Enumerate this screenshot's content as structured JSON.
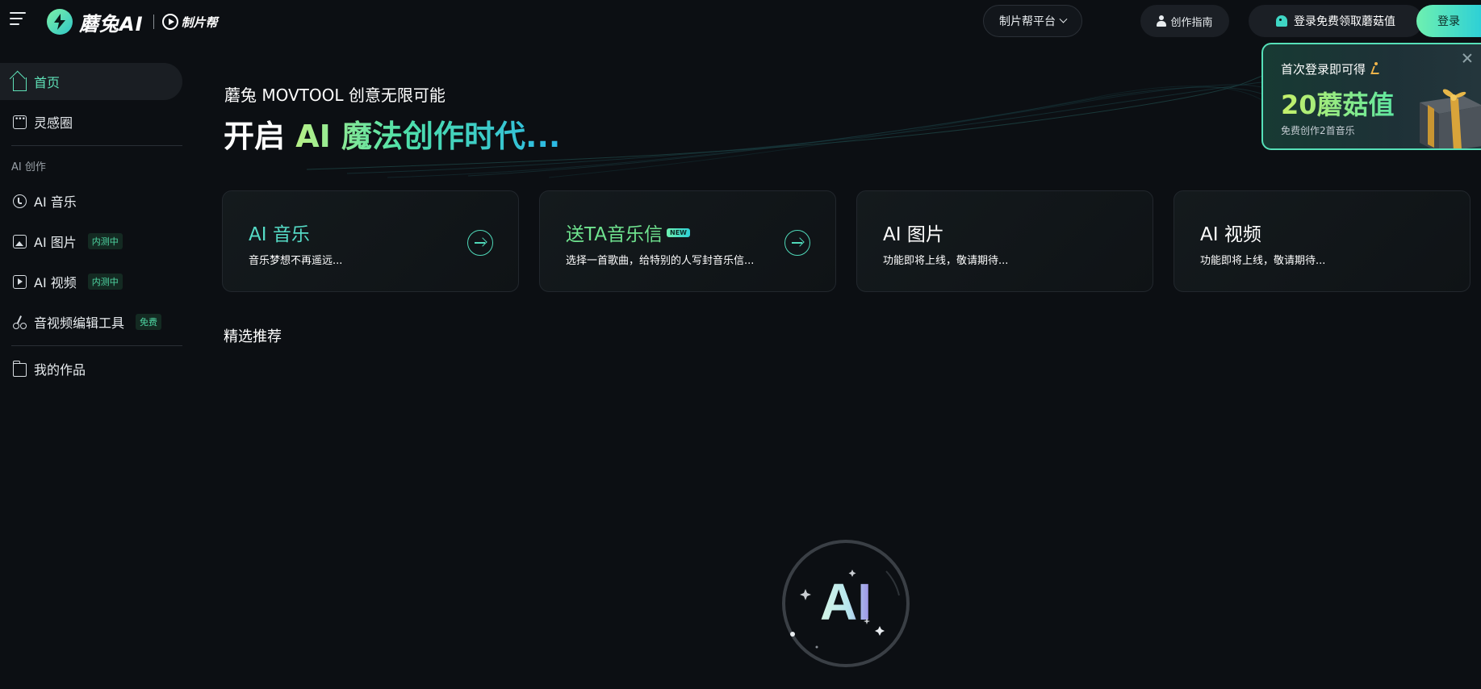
{
  "header": {
    "logo_text": "蘑兔AI",
    "logo_sub": "制片帮",
    "platform_label": "制片帮平台",
    "guide_label": "创作指南",
    "promo_label": "登录免费领取蘑菇值",
    "login_label": "登录"
  },
  "sidebar": {
    "items": [
      {
        "label": "首页"
      },
      {
        "label": "灵感圈"
      },
      {
        "label": "AI 音乐"
      },
      {
        "label": "AI 图片",
        "tag": "内测中"
      },
      {
        "label": "AI 视频",
        "tag": "内测中"
      },
      {
        "label": "音视频编辑工具",
        "tag": "免费"
      },
      {
        "label": "我的作品"
      }
    ],
    "group_label": "AI 创作"
  },
  "hero": {
    "subtitle": "蘑兔 MOVTOOL 创意无限可能",
    "title_plain": "开启",
    "title_gradient": "AI 魔法创作时代..."
  },
  "cards": [
    {
      "title": "AI 音乐",
      "desc": "音乐梦想不再遥远..."
    },
    {
      "title": "送TA音乐信",
      "badge": "NEW",
      "desc": "选择一首歌曲，给特别的人写封音乐信..."
    },
    {
      "title": "AI 图片",
      "desc": "功能即将上线，敬请期待..."
    },
    {
      "title": "AI 视频",
      "desc": "功能即将上线，敬请期待..."
    }
  ],
  "section": {
    "title": "精选推荐"
  },
  "loader": {
    "text": "AI"
  },
  "popup": {
    "title": "首次登录即可得",
    "amount": "20蘑菇值",
    "desc": "免费创作2首音乐"
  },
  "colors": {
    "accent": "#5fe0b7",
    "background": "#0c0f13",
    "card_border": "#22272d"
  }
}
